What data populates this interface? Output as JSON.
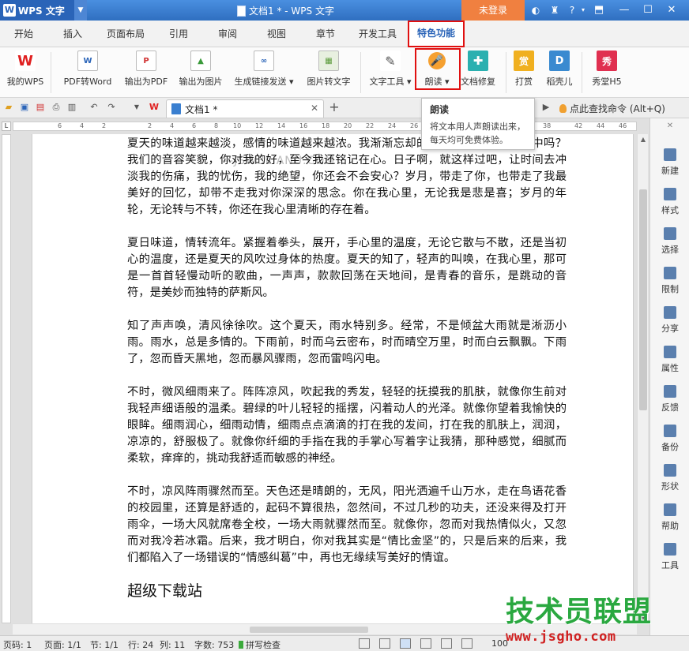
{
  "title_bar": {
    "app_name": "WPS 文字",
    "doc_title": "文档1 * - WPS 文字",
    "login": "未登录",
    "help": "?"
  },
  "menu_tabs": [
    "开始",
    "插入",
    "页面布局",
    "引用",
    "审阅",
    "视图",
    "章节",
    "开发工具"
  ],
  "active_tab": "特色功能",
  "ribbon": {
    "my_wps": "我的WPS",
    "pdf_to_word": "PDF转Word",
    "export_pdf": "输出为PDF",
    "export_image": "输出为图片",
    "gen_link": "生成链接发送",
    "img_to_text": "图片转文字",
    "text_tools": "文字工具",
    "read_aloud": "朗读",
    "doc_repair": "文档修复",
    "reward": "打赏",
    "daoke": "稻壳儿",
    "xiutang": "秀堂H5"
  },
  "quickbar": {
    "doc_tab": "文档1 *",
    "find_command": "点此查找命令 (Alt+Q)"
  },
  "tooltip": {
    "title": "朗读",
    "body": "将文本用人声朗读出来，每天均可免费体验。"
  },
  "page_watermark": "—JSW3LIANU.COM",
  "document": {
    "paragraphs": [
      "夏天的味道越来越淡，感情的味道越来越浓。我渐渐忘却的朋友，你们还在我心中吗？我们的音容笑貌，你对我的好，至今我还铭记在心。日子啊，就这样过吧，让时间去冲淡我的伤痛，我的忧伤，我的绝望，你还会不会安心？岁月，带走了你，也带走了我最美好的回忆，却带不走我对你深深的思念。你在我心里，无论我是悲是喜；岁月的年轮，无论转与不转，你还在我心里清晰的存在着。",
      "夏日味道，情转流年。紧握着拳头，展开，手心里的温度，无论它散与不散，还是当初心的温度，还是夏天的风吹过身体的热度。夏天的知了，轻声的叫唤，在我心里，那可是一首首轻慢动听的歌曲，一声声，款款回荡在天地间，是青春的音乐，是跳动的音符，是美妙而独特的萨斯风。",
      "知了声声唤，清风徐徐吹。这个夏天，雨水特别多。经常，不是倾盆大雨就是淅沥小雨。雨水，总是多情的。下雨前，时而乌云密布，时而晴空万里，时而白云飘飘。下雨了，忽而昏天黑地，忽而暴风骤雨，忽而雷鸣闪电。",
      "不时，微风细雨来了。阵阵凉风，吹起我的秀发，轻轻的抚摸我的肌肤，就像你生前对我轻声细语般的温柔。碧绿的叶儿轻轻的摇摆，闪着动人的光泽。就像你望着我愉快的眼眸。细雨润心，细雨动情，细雨点点滴滴的打在我的发间，打在我的肌肤上，润润，凉凉的，舒服极了。就像你纤细的手指在我的手掌心写着字让我猜，那种感觉，细腻而柔软，痒痒的，挑动我舒适而敏感的神经。",
      "不时，凉风阵雨骤然而至。天色还是晴朗的，无风，阳光洒遍千山万水，走在鸟语花香的校园里，还算是舒适的，起码不算很热，忽然间，不过几秒的功夫，还没来得及打开雨伞，一场大风就席卷全校，一场大雨就骤然而至。就像你，忽而对我热情似火，又忽而对我冷若冰霜。后来，我才明白，你对我其实是“情比金坚”的，只是后来的后来，我们都陷入了一场错误的“情感纠葛”中，再也无缘续写美好的情谊。"
    ],
    "heading": "超级下载站"
  },
  "side_pane": [
    "新建",
    "样式",
    "选择",
    "限制",
    "分享",
    "属性",
    "反馈",
    "备份",
    "形状",
    "帮助",
    "工具"
  ],
  "status_bar": {
    "page_code": "页码: 1",
    "page": "页面: 1/1",
    "section": "节: 1/1",
    "row": "行: 24",
    "col": "列: 11",
    "word_count": "字数: 753",
    "spell_check": "拼写检查",
    "zoom": "100"
  },
  "logo": {
    "name": "技术员联盟",
    "url": "www.jsgho.com"
  }
}
